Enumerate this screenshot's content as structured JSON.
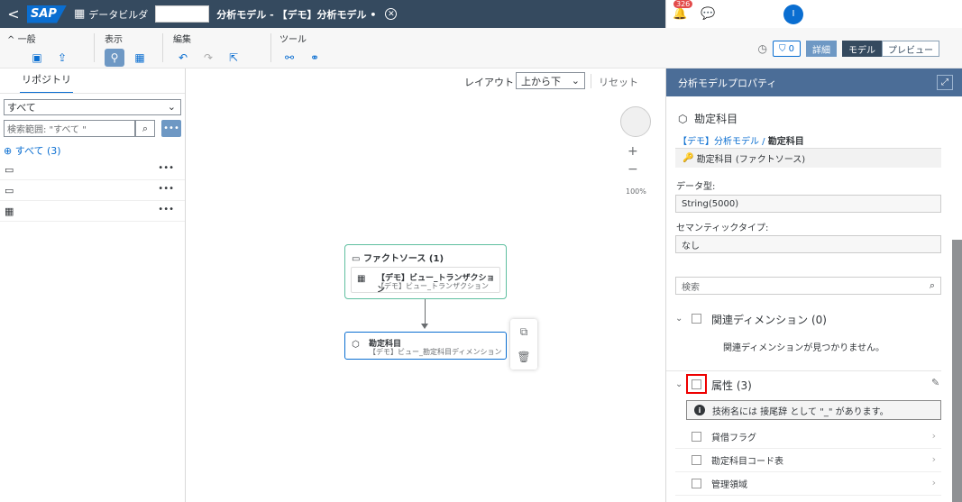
{
  "shell": {
    "back": "<",
    "logo": "SAP",
    "app_name": "データビルダ",
    "model_title": "分析モデル - 【デモ】分析モデル •",
    "notif_count": "326",
    "avatar": "I"
  },
  "toolbar": {
    "general": "一般",
    "view": "表示",
    "edit": "編集",
    "tools": "ツール",
    "status_count": "0",
    "details": "詳細",
    "model": "モデル",
    "preview": "プレビュー"
  },
  "left": {
    "tab": "リポジトリ",
    "filter_value": "すべて",
    "search_placeholder": "検索範囲: \"すべて \"",
    "all_label": "すべて (3)",
    "more": "•••"
  },
  "canvas": {
    "layout_label": "レイアウト",
    "layout_value": "上から下",
    "reset": "リセット",
    "zoom_pct": "100%",
    "fact_node_title": "ファクトソース (1)",
    "fact_item_name": "【デモ】ビュー_トランザクション",
    "fact_item_sub": "【デモ】ビュー_トランザクション",
    "dim_node_name": "勘定科目",
    "dim_node_sub": "【デモ】ビュー_勘定科目ディメンション"
  },
  "properties": {
    "header": "分析モデルプロパティ",
    "title": "勘定科目",
    "crumb_link": "【デモ】分析モデル",
    "crumb_sep": " / ",
    "crumb_current": "勘定科目",
    "fact_source": "勘定科目 (ファクトソース)",
    "datatype_label": "データ型:",
    "datatype_value": "String(5000)",
    "semantic_label": "セマンティックタイプ:",
    "semantic_value": "なし",
    "search_placeholder": "検索",
    "related_dims": "関連ディメンション (0)",
    "no_dims": "関連ディメンションが見つかりません。",
    "attributes": "属性 (3)",
    "info_msg": "技術名には 接尾辞 として \"_\" があります。",
    "attr_items": [
      "貸借フラグ",
      "勘定科目コード表",
      "管理領域"
    ]
  }
}
